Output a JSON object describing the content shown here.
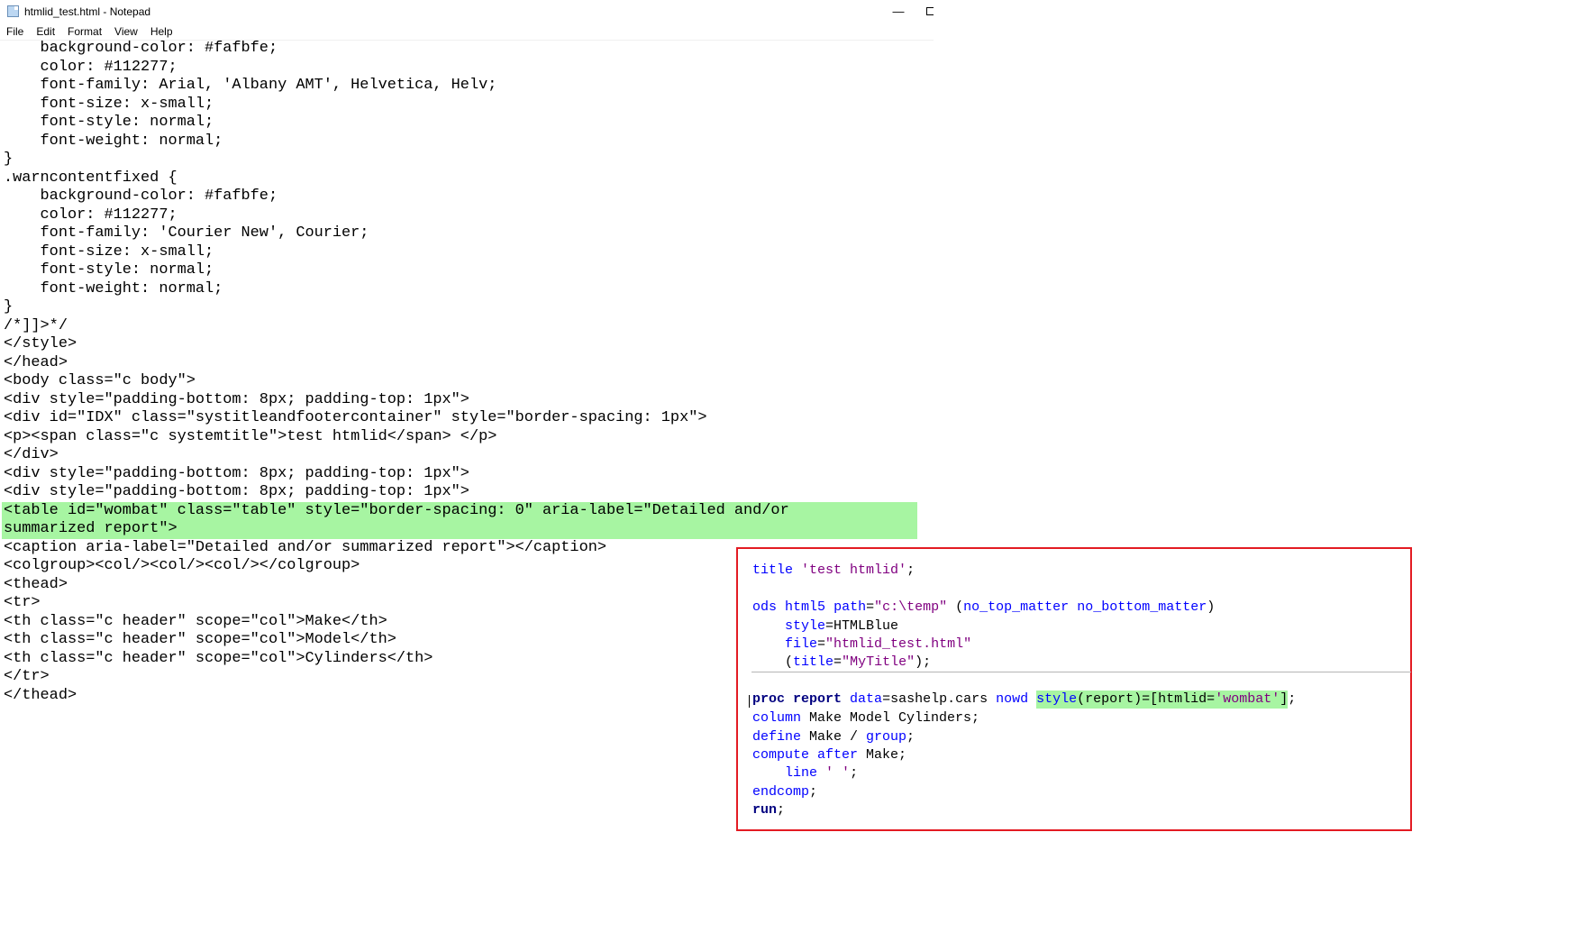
{
  "window": {
    "title": "htmlid_test.html - Notepad",
    "minimize_glyph": "—"
  },
  "menu": {
    "items": [
      "File",
      "Edit",
      "Format",
      "View",
      "Help"
    ]
  },
  "editor": {
    "lines": [
      "    background-color: #fafbfe;",
      "    color: #112277;",
      "    font-family: Arial, 'Albany AMT', Helvetica, Helv;",
      "    font-size: x-small;",
      "    font-style: normal;",
      "    font-weight: normal;",
      "}",
      ".warncontentfixed {",
      "    background-color: #fafbfe;",
      "    color: #112277;",
      "    font-family: 'Courier New', Courier;",
      "    font-size: x-small;",
      "    font-style: normal;",
      "    font-weight: normal;",
      "}",
      "/*]]>*/",
      "</style>",
      "</head>",
      "<body class=\"c body\">",
      "<div style=\"padding-bottom: 8px; padding-top: 1px\">",
      "<div id=\"IDX\" class=\"systitleandfootercontainer\" style=\"border-spacing: 1px\">",
      "<p><span class=\"c systemtitle\">test htmlid</span> </p>",
      "</div>",
      "<div style=\"padding-bottom: 8px; padding-top: 1px\">",
      "<div style=\"padding-bottom: 8px; padding-top: 1px\">",
      "<table id=\"wombat\" class=\"table\" style=\"border-spacing: 0\" aria-label=\"Detailed and/or",
      "summarized report\">",
      "<caption aria-label=\"Detailed and/or summarized report\"></caption>",
      "<colgroup><col/><col/><col/></colgroup>",
      "<thead>",
      "<tr>",
      "<th class=\"c header\" scope=\"col\">Make</th>",
      "<th class=\"c header\" scope=\"col\">Model</th>",
      "<th class=\"c header\" scope=\"col\">Cylinders</th>",
      "</tr>",
      "</thead>"
    ],
    "highlight_color": "#a7f5a2"
  },
  "sas_code": {
    "border_color": "#e31b23",
    "title_stmt": {
      "kw": "title",
      "str": "'test htmlid'",
      "end": ";"
    },
    "ods_stmt": {
      "kw1": "ods",
      "kw2": "html5",
      "kw3": "path",
      "eq": "=",
      "path": "\"c:\\temp\"",
      "sp": " ",
      "open": "(",
      "opt1": "no_top_matter",
      "opt2": "no_bottom_matter",
      "close": ")"
    },
    "style_stmt": {
      "kw": "style",
      "rest": "=HTMLBlue"
    },
    "file_stmt": {
      "kw": "file",
      "eq": "=",
      "str": "\"htmlid_test.html\""
    },
    "title_opt": {
      "open": "(",
      "kw": "title",
      "eq": "=",
      "str": "\"MyTitle\"",
      "end": ");"
    },
    "proc_stmt": {
      "kw": "proc report",
      "data_kw": "data",
      "data_val": "=sashelp.cars",
      "nowd": "nowd",
      "style_kw": "style",
      "style_rest": "(report)=[htmlid=",
      "style_str": "'wombat'",
      "style_close": "]",
      "end": ";"
    },
    "column_stmt": {
      "kw": "column",
      "rest": " Make Model Cylinders;"
    },
    "define_stmt": {
      "kw": "define",
      "rest": " Make / ",
      "opt": "group",
      "end": ";"
    },
    "compute_stmt": {
      "kw": "compute after",
      "rest": " Make;"
    },
    "line_stmt": {
      "kw": "line",
      "str": "' '",
      "end": ";"
    },
    "endcomp_stmt": {
      "kw": "endcomp",
      "end": ";"
    },
    "run_stmt": {
      "kw": "run",
      "end": ";"
    }
  }
}
